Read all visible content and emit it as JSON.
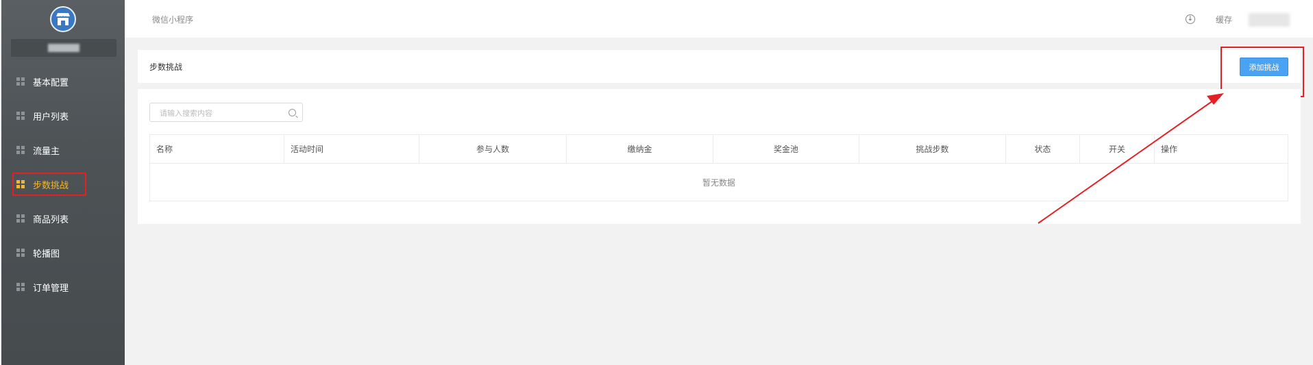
{
  "sidebar": {
    "items": [
      {
        "label": "基本配置",
        "active": false
      },
      {
        "label": "用户列表",
        "active": false
      },
      {
        "label": "流量主",
        "active": false
      },
      {
        "label": "步数挑战",
        "active": true
      },
      {
        "label": "商品列表",
        "active": false
      },
      {
        "label": "轮播图",
        "active": false
      },
      {
        "label": "订单管理",
        "active": false
      }
    ]
  },
  "topbar": {
    "brand": "微信小程序",
    "cache_label": "缓存",
    "download_icon": "download-circle-icon"
  },
  "page": {
    "title": "步数挑战",
    "add_button": "添加挑战"
  },
  "search": {
    "placeholder": "请输入搜索内容"
  },
  "table": {
    "columns": [
      "名称",
      "活动时间",
      "参与人数",
      "缴纳金",
      "奖金池",
      "挑战步数",
      "状态",
      "开关",
      "操作"
    ],
    "empty_text": "暂无数据"
  },
  "colors": {
    "accent_blue": "#4aa3f2",
    "active_nav": "#f0b637",
    "annotation_red": "#e42025",
    "sidebar_bg": "#50565a"
  }
}
